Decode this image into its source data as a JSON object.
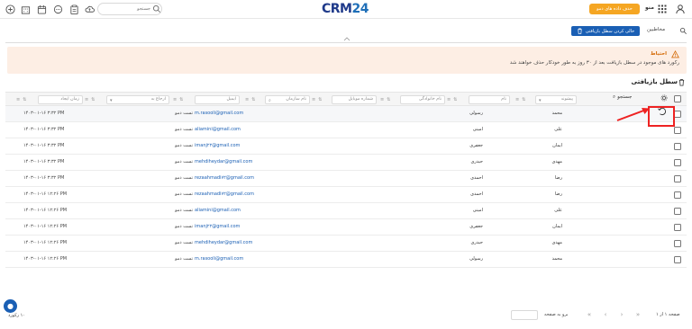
{
  "topbar": {
    "search_placeholder": "جستجو",
    "logo_left": "CRM",
    "logo_right": "24",
    "demo_button": "حذف داده های دمو",
    "menu_label": "منو"
  },
  "subbar": {
    "empty_trash_button": "خالی کردن سطل بازیافتی",
    "contacts_link": "مخاطبین"
  },
  "warning": {
    "title": "احتیاط",
    "text": "رکورد های موجود در سطل بازیافت بعد از ۳۰ روز به طور خودکار حذف خواهند شد"
  },
  "page": {
    "title": "سطل بازیافتی"
  },
  "table": {
    "search_label": "جستجو",
    "header_filters": {
      "prefix": "پیشوند",
      "first_name": "نام",
      "last_name": "نام خانوادگی",
      "mobile": "شماره موبایل",
      "org": "نام سازمان",
      "email": "ایمیل",
      "referred_to": "ارجاع به",
      "created_at": "زمان ایجاد"
    },
    "rows": [
      {
        "first_name": "محمد",
        "last_name": "رسولی",
        "email": "m.rasooli@gmail.com",
        "referred_to": "تست دمو",
        "created_at": "۱۴۰۳-۰۱-۱۶ ۳:۳۲ PM"
      },
      {
        "first_name": "علی",
        "last_name": "امینی",
        "email": "aliamini@gmail.com",
        "referred_to": "تست دمو",
        "created_at": "۱۴۰۳-۰۱-۱۶ ۳:۳۲ PM"
      },
      {
        "first_name": "ایمان",
        "last_name": "جعفری",
        "email": "imanj۲۲@gmail.com",
        "referred_to": "تست دمو",
        "created_at": "۱۴۰۳-۰۱-۱۶ ۳:۳۲ PM"
      },
      {
        "first_name": "مهدی",
        "last_name": "حیدری",
        "email": "mehdiheydar@gmail.com",
        "referred_to": "تست دمو",
        "created_at": "۱۴۰۳-۰۱-۱۶ ۳:۳۲ PM"
      },
      {
        "first_name": "رضا",
        "last_name": "احمدی",
        "email": "rezaahmadi۷۲@gmail.com",
        "referred_to": "تست دمو",
        "created_at": "۱۴۰۳-۰۱-۱۶ ۳:۳۲ PM"
      },
      {
        "first_name": "رضا",
        "last_name": "احمدی",
        "email": "rezaahmadi۷۲@gmail.com",
        "referred_to": "تست دمو",
        "created_at": "۱۴۰۳-۰۱-۱۶ ۱۲:۲۶ PM"
      },
      {
        "first_name": "علی",
        "last_name": "امینی",
        "email": "aliamini@gmail.com",
        "referred_to": "تست دمو",
        "created_at": "۱۴۰۳-۰۱-۱۶ ۱۲:۲۶ PM"
      },
      {
        "first_name": "ایمان",
        "last_name": "جعفری",
        "email": "imanj۲۲@gmail.com",
        "referred_to": "تست دمو",
        "created_at": "۱۴۰۳-۰۱-۱۶ ۱۲:۲۶ PM"
      },
      {
        "first_name": "مهدی",
        "last_name": "حیدری",
        "email": "mehdiheydar@gmail.com",
        "referred_to": "تست دمو",
        "created_at": "۱۴۰۳-۰۱-۱۶ ۱۲:۲۶ PM"
      },
      {
        "first_name": "محمد",
        "last_name": "رسولی",
        "email": "m.rasooli@gmail.com",
        "referred_to": "تست دمو",
        "created_at": "۱۴۰۳-۰۱-۱۶ ۱۲:۲۶ PM"
      }
    ]
  },
  "footer": {
    "page_info": "صفحه ۱ از ۱",
    "go_to_page": "برو به صفحه",
    "records": "۱۰ رکورد"
  },
  "colors": {
    "primary": "#1a5fb4",
    "demo_orange": "#f5a623",
    "warning_bg": "#fdeee4",
    "highlight_red": "#e22"
  }
}
